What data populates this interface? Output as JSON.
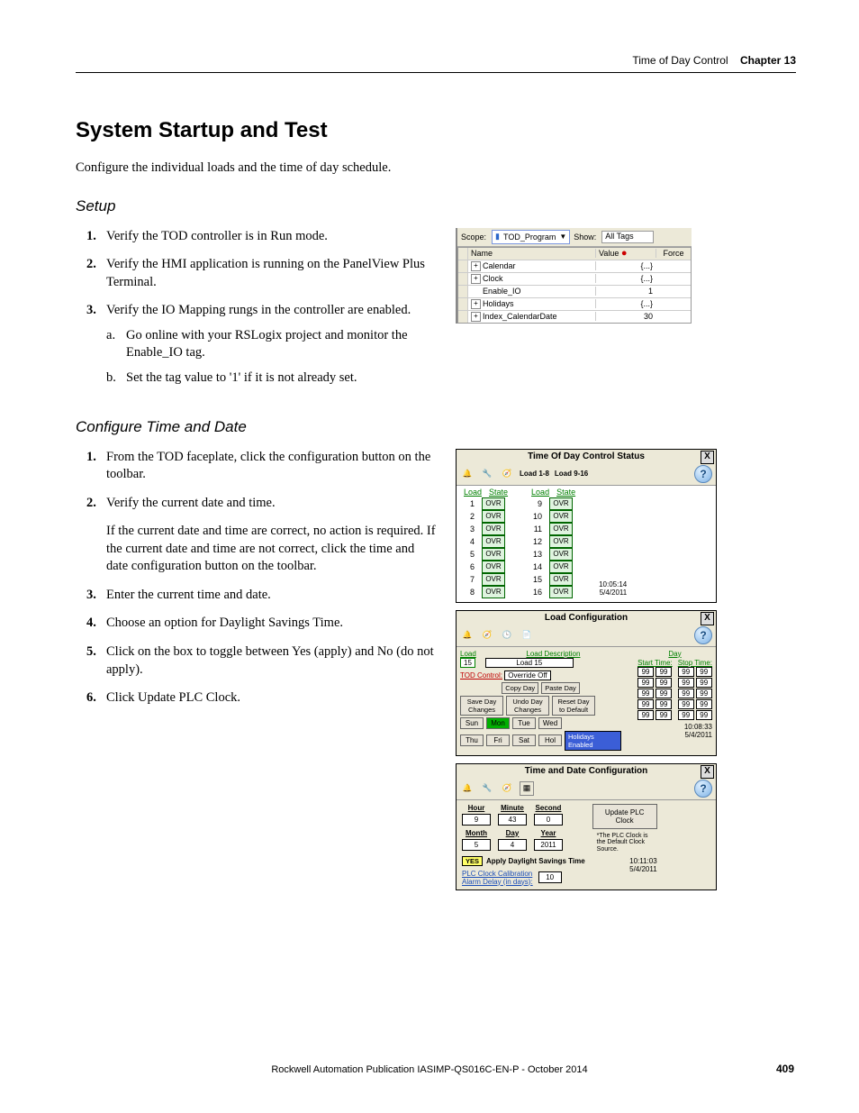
{
  "header": {
    "section": "Time of Day Control",
    "chapter": "Chapter 13"
  },
  "h1": "System Startup and Test",
  "intro": "Configure the individual loads and the time of day schedule.",
  "setup": {
    "heading": "Setup",
    "steps": [
      "Verify the TOD controller is in Run mode.",
      "Verify the HMI application is running on the PanelView Plus Terminal.",
      "Verify the IO Mapping rungs in the controller are enabled."
    ],
    "sub3": [
      "Go online with your RSLogix project and monitor the Enable_IO tag.",
      "Set the tag value to '1' if it is not already set."
    ]
  },
  "cfg": {
    "heading": "Configure Time and Date",
    "steps": [
      "From the TOD faceplate, click the configuration button on the toolbar.",
      "Verify the current date and time.",
      "Enter the current time and date.",
      "Choose an option for Daylight Savings Time.",
      "Click on the box to toggle between Yes (apply) and No (do not apply).",
      "Click Update PLC Clock."
    ],
    "note2": "If the current date and time are correct, no action is required. If the current date and time are not correct, click the time and date configuration button on the toolbar."
  },
  "footer": "Rockwell Automation Publication IASIMP-QS016C-EN-P - October 2014",
  "pagenum": "409",
  "tagbrowser": {
    "scope_label": "Scope:",
    "scope_value": "TOD_Program",
    "show_label": "Show:",
    "show_value": "All Tags",
    "cols": {
      "name": "Name",
      "value": "Value",
      "force": "Force"
    },
    "rows": [
      {
        "name": "Calendar",
        "value": "{...}",
        "exp": "+"
      },
      {
        "name": "Clock",
        "value": "{...}",
        "exp": "+"
      },
      {
        "name": "Enable_IO",
        "value": "1",
        "exp": ""
      },
      {
        "name": "Holidays",
        "value": "{...}",
        "exp": "+"
      },
      {
        "name": "Index_CalendarDate",
        "value": "30",
        "exp": "+"
      }
    ]
  },
  "tod_status": {
    "title": "Time Of Day Control Status",
    "load18": "Load 1-8",
    "load916": "Load 9-16",
    "head_load": "Load",
    "head_state": "State",
    "state": "OVR",
    "loads_a": [
      "1",
      "2",
      "3",
      "4",
      "5",
      "6",
      "7",
      "8"
    ],
    "loads_b": [
      "9",
      "10",
      "11",
      "12",
      "13",
      "14",
      "15",
      "16"
    ],
    "time": "10:05:14",
    "date": "5/4/2011"
  },
  "loadcfg": {
    "title": "Load Configuration",
    "load_h": "Load",
    "desc_h": "Load Description",
    "day_h": "Day",
    "load_num": "15",
    "desc": "Load 15",
    "tod_label": "TOD Control:",
    "tod_value": "Override Off",
    "copy_day": "Copy Day",
    "paste_day": "Paste Day",
    "save_day": "Save Day Changes",
    "undo_day": "Undo Day Changes",
    "reset_day": "Reset Day to Default",
    "days": [
      "Sun",
      "Mon",
      "Tue",
      "Wed",
      "Thu",
      "Fri",
      "Sat",
      "Hol"
    ],
    "holidays": "Holidays Enabled",
    "start": "Start Time:",
    "stop": "Stop Time:",
    "ts": "10:08:33",
    "date": "5/4/2011",
    "cell": "99"
  },
  "tdcfg": {
    "title": "Time and Date Configuration",
    "hour_h": "Hour",
    "minute_h": "Minute",
    "second_h": "Second",
    "month_h": "Month",
    "day_h": "Day",
    "year_h": "Year",
    "hour": "9",
    "minute": "43",
    "second": "0",
    "month": "5",
    "day": "4",
    "year": "2011",
    "update": "Update PLC Clock",
    "note": "*The PLC Clock is the Default Clock Source.",
    "yes": "YES",
    "dst": "Apply Daylight Savings Time",
    "calib1": "PLC Clock Calibration",
    "calib2": "Alarm Delay (in days):",
    "calib_val": "10",
    "ts": "10:11:03",
    "date": "5/4/2011"
  }
}
